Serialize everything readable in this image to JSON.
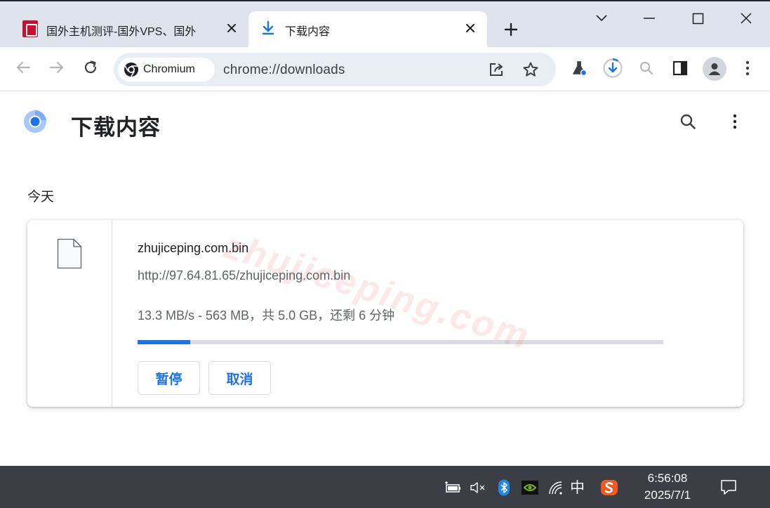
{
  "tabs": [
    {
      "title": "国外主机测评-国外VPS、国外",
      "close_label": "✕"
    },
    {
      "title": "下载内容",
      "close_label": "✕"
    }
  ],
  "new_tab_label": "+",
  "omnibox": {
    "chip_label": "Chromium",
    "url": "chrome://downloads"
  },
  "page": {
    "title": "下载内容",
    "section_date": "今天"
  },
  "watermark": "zhujiceping.com",
  "download": {
    "file_name": "zhujiceping.com.bin",
    "url": "http://97.64.81.65/zhujiceping.com.bin",
    "status": "13.3 MB/s - 563 MB，共 5.0 GB，还剩 6 分钟",
    "progress_fraction": 0.1,
    "pause_label": "暂停",
    "cancel_label": "取消"
  },
  "taskbar": {
    "ime_label": "中",
    "time": "6:56:08",
    "date": "2025/7/1"
  },
  "colors": {
    "accent": "#1a73e8",
    "titlebar": "#dfe3eb",
    "omnibox": "#e9edf4",
    "taskbar": "#3b3e44"
  },
  "icons": [
    "site-favicon-icon",
    "download-arrow-icon",
    "close-icon",
    "plus-icon",
    "chevron-down-icon",
    "minimize-icon",
    "maximize-icon",
    "back-arrow-icon",
    "forward-arrow-icon",
    "reload-icon",
    "chromium-icon",
    "share-icon",
    "star-icon",
    "labs-flask-icon",
    "download-progress-icon",
    "zoom-search-icon",
    "side-panel-icon",
    "profile-avatar-icon",
    "more-vert-icon",
    "chromium-logo-icon",
    "search-icon",
    "file-icon",
    "battery-icon",
    "volume-muted-icon",
    "bluetooth-icon",
    "nvidia-icon",
    "wifi-icon",
    "sogou-ime-icon",
    "notification-icon"
  ]
}
